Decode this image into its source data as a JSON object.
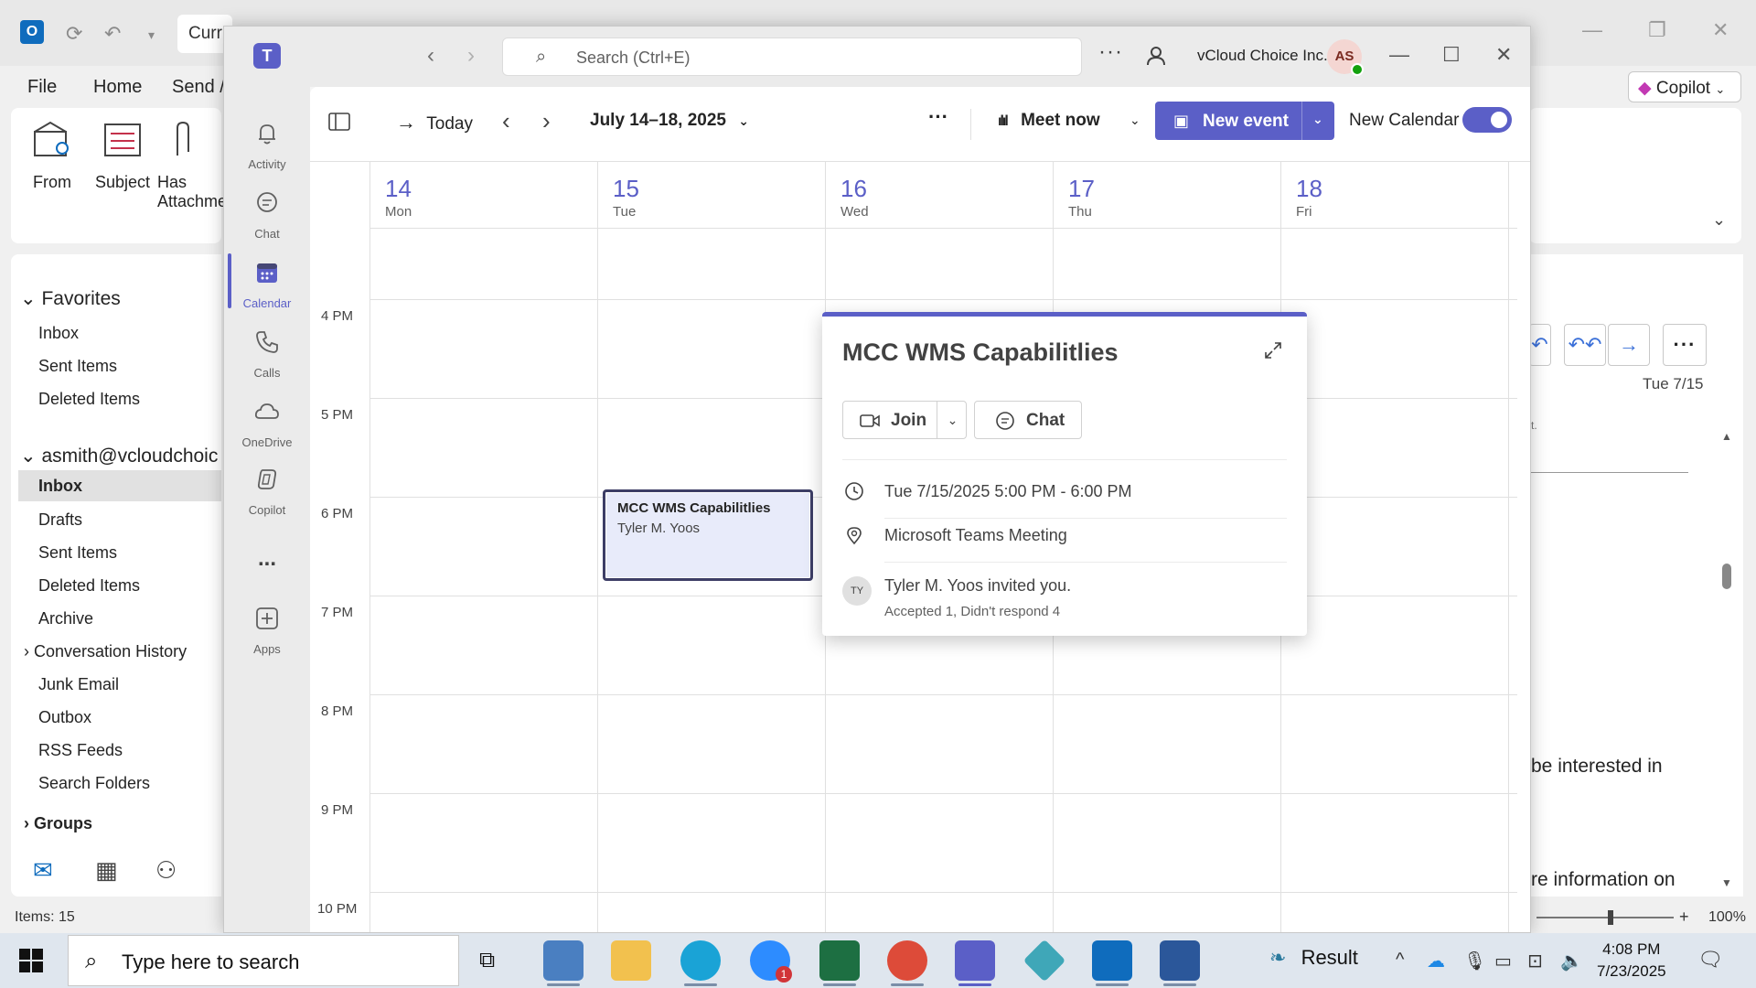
{
  "outlook": {
    "search_partial": "Curr",
    "menu": [
      "File",
      "Home",
      "Send /"
    ],
    "ribbon_buttons": [
      "From",
      "Subject",
      "Has",
      "Attachme"
    ],
    "copilot_label": "Copilot",
    "favorites": {
      "heading": "Favorites",
      "items": [
        "Inbox",
        "Sent Items",
        "Deleted Items"
      ]
    },
    "account": {
      "heading": "asmith@vcloudchoic",
      "items": [
        "Inbox",
        "Drafts",
        "Sent Items",
        "Deleted Items",
        "Archive",
        "Conversation History",
        "Junk Email",
        "Outbox",
        "RSS Feeds",
        "Search Folders"
      ],
      "selected_index": 0
    },
    "groups_heading": "Groups",
    "status_items": "Items: 15",
    "reading_date": "Tue 7/15",
    "reading_text_1": "be interested in",
    "reading_text_2": "re information on",
    "reading_text_3": "t.",
    "zoom": "100%"
  },
  "teams": {
    "search_placeholder": "Search (Ctrl+E)",
    "org_name": "vCloud Choice Inc.",
    "avatar_initials": "AS",
    "rail": [
      {
        "label": "Activity",
        "icon": "bell-icon"
      },
      {
        "label": "Chat",
        "icon": "chat-icon"
      },
      {
        "label": "Calendar",
        "icon": "calendar-icon",
        "active": true
      },
      {
        "label": "Calls",
        "icon": "phone-icon"
      },
      {
        "label": "OneDrive",
        "icon": "cloud-icon"
      },
      {
        "label": "Copilot",
        "icon": "copilot-icon"
      },
      {
        "label": "...",
        "icon": "more-icon"
      },
      {
        "label": "Apps",
        "icon": "add-apps-icon"
      }
    ],
    "toolbar": {
      "today_label": "Today",
      "date_range": "July 14–18, 2025",
      "more_label": "···",
      "meet_now_label": "Meet now",
      "new_event_label": "New event",
      "new_calendar_label": "New Calendar",
      "new_calendar_enabled": true
    },
    "days": [
      {
        "num": "14",
        "name": "Mon"
      },
      {
        "num": "15",
        "name": "Tue"
      },
      {
        "num": "16",
        "name": "Wed"
      },
      {
        "num": "17",
        "name": "Thu"
      },
      {
        "num": "18",
        "name": "Fri"
      }
    ],
    "hours": [
      "4 PM",
      "5 PM",
      "6 PM",
      "7 PM",
      "8 PM",
      "9 PM",
      "10 PM"
    ],
    "event": {
      "title": "MCC WMS Capabilitlies",
      "organizer": "Tyler M. Yoos"
    },
    "popup": {
      "title": "MCC WMS Capabilitlies",
      "join_label": "Join",
      "chat_label": "Chat",
      "datetime": "Tue 7/15/2025 5:00 PM - 6:00 PM",
      "location": "Microsoft Teams Meeting",
      "organizer_initials": "TY",
      "invite_text": "Tyler M. Yoos invited you.",
      "response_summary": "Accepted 1, Didn't respond 4"
    }
  },
  "taskbar": {
    "search_placeholder": "Type here to search",
    "widget_label": "Result",
    "zoom_badge": "1",
    "time": "4:08 PM",
    "date": "7/23/2025"
  }
}
